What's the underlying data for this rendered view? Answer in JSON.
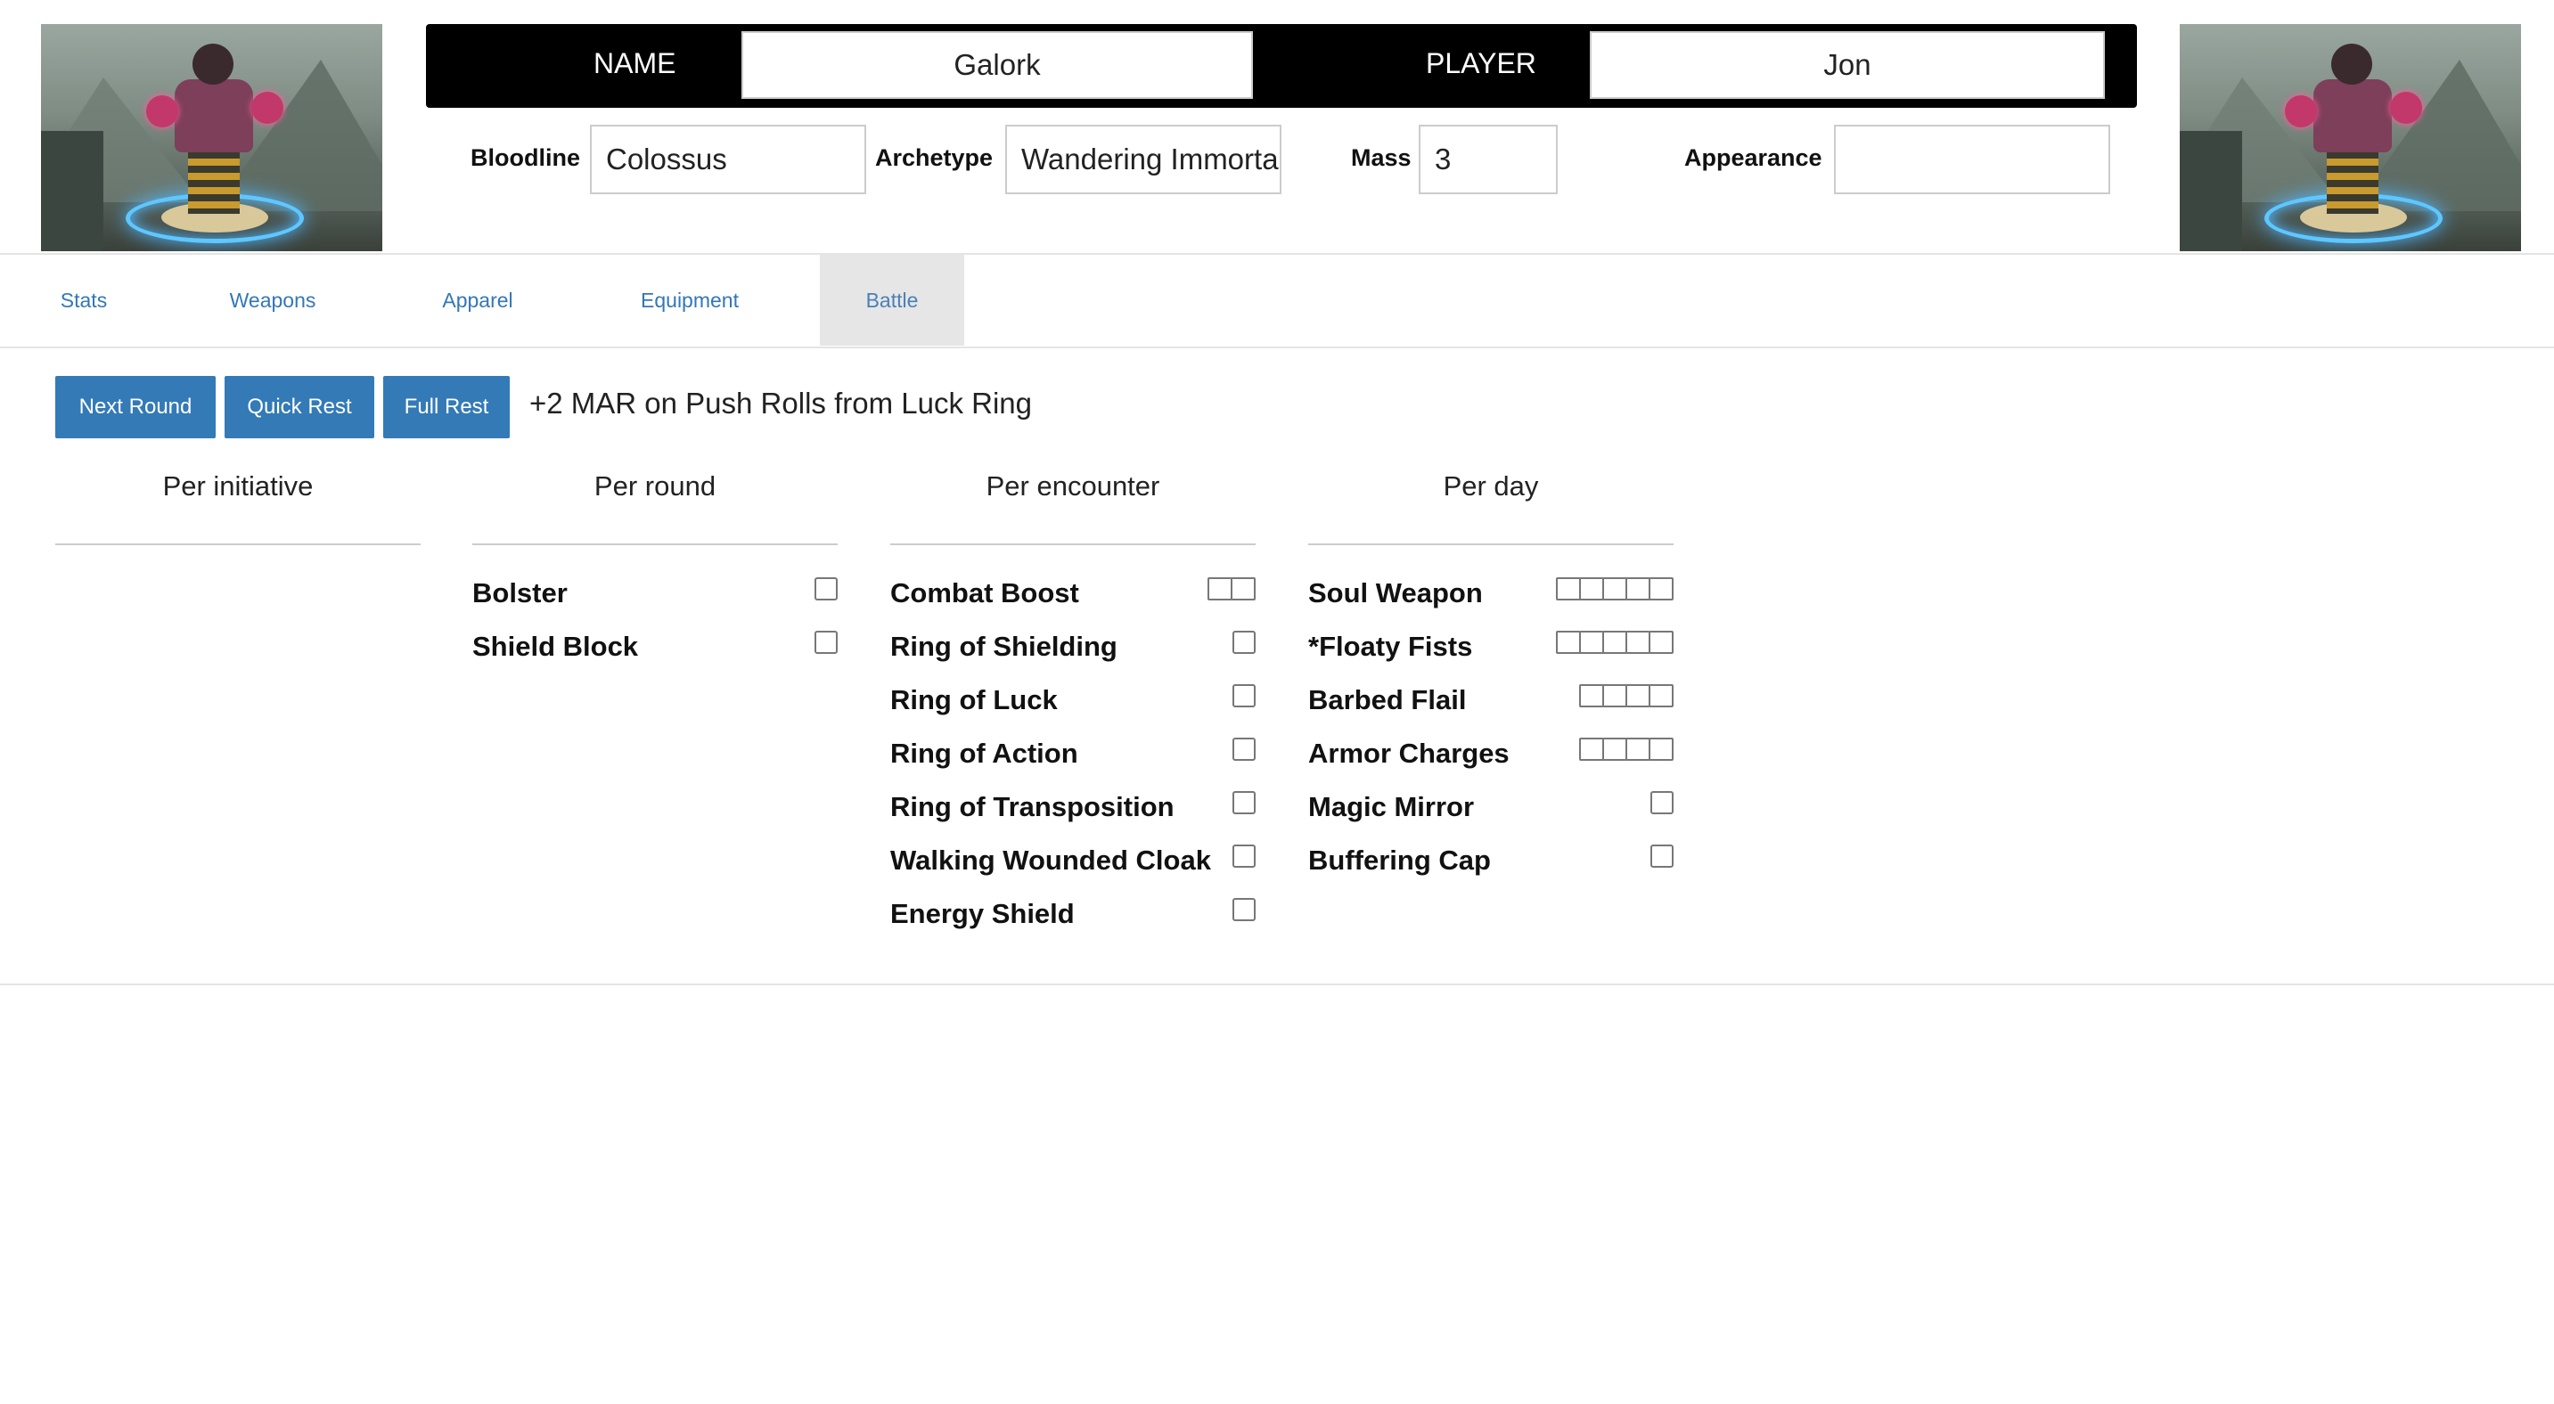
{
  "header": {
    "name_label": "NAME",
    "name_value": "Galork",
    "player_label": "PLAYER",
    "player_value": "Jon",
    "bloodline_label": "Bloodline",
    "bloodline_value": "Colossus",
    "archetype_label": "Archetype",
    "archetype_value": "Wandering Immortal",
    "mass_label": "Mass",
    "mass_value": "3",
    "appearance_label": "Appearance",
    "appearance_value": ""
  },
  "tabs": [
    {
      "label": "Stats",
      "active": false
    },
    {
      "label": "Weapons",
      "active": false
    },
    {
      "label": "Apparel",
      "active": false
    },
    {
      "label": "Equipment",
      "active": false
    },
    {
      "label": "Battle",
      "active": true
    }
  ],
  "battle": {
    "buttons": {
      "next_round": "Next Round",
      "quick_rest": "Quick Rest",
      "full_rest": "Full Rest"
    },
    "note": "+2 MAR on Push Rolls from Luck Ring",
    "columns": [
      {
        "title": "Per initiative",
        "items": []
      },
      {
        "title": "Per round",
        "items": [
          {
            "name": "Bolster",
            "uses": 1
          },
          {
            "name": "Shield Block",
            "uses": 1
          }
        ]
      },
      {
        "title": "Per encounter",
        "items": [
          {
            "name": "Combat Boost",
            "uses": 2
          },
          {
            "name": "Ring of Shielding",
            "uses": 1
          },
          {
            "name": "Ring of Luck",
            "uses": 1
          },
          {
            "name": "Ring of Action",
            "uses": 1
          },
          {
            "name": "Ring of Transposition",
            "uses": 1
          },
          {
            "name": "Walking Wounded Cloak",
            "uses": 1
          },
          {
            "name": "Energy Shield",
            "uses": 1
          }
        ]
      },
      {
        "title": "Per day",
        "items": [
          {
            "name": "Soul Weapon",
            "uses": 5
          },
          {
            "name": "*Floaty Fists",
            "uses": 5
          },
          {
            "name": "Barbed Flail",
            "uses": 4
          },
          {
            "name": "Armor Charges",
            "uses": 4
          },
          {
            "name": "Magic Mirror",
            "uses": 1
          },
          {
            "name": "Buffering Cap",
            "uses": 1
          }
        ]
      }
    ]
  },
  "colors": {
    "button_bg": "#337ab7",
    "tab_link": "#3377b7",
    "active_tab_bg": "#e6e6e6",
    "header_bar": "#000000"
  }
}
